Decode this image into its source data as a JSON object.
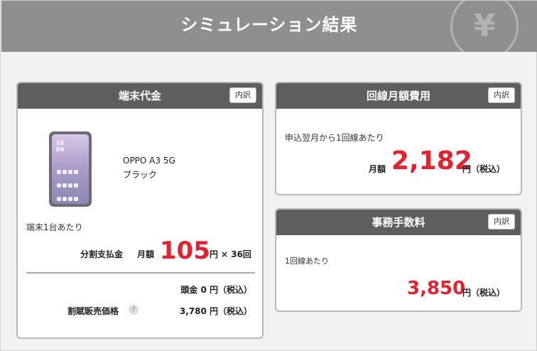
{
  "banner": {
    "title": "シミュレーション結果",
    "icon": "yen-icon",
    "icon_glyph": "¥"
  },
  "device_card": {
    "title": "端末代金",
    "detail_label": "内訳",
    "phone_clock": "10\n00",
    "product_name": "OPPO A3 5G",
    "product_color": "ブラック",
    "per_unit": "端末1台あたり",
    "payment_label": "分割支払金",
    "monthly_label": "月額",
    "monthly_amount": "105",
    "unit": "円",
    "installments": "× 36回",
    "down_payment": "頭金 0 円（税込）",
    "discount_label": "割賦販売価格",
    "discount_value": "3,780 円（税込）"
  },
  "monthly_card": {
    "title": "回線月額費用",
    "detail_label": "内訳",
    "note": "申込翌月から1回線あたり",
    "monthly_label": "月額",
    "amount": "2,182",
    "unit": "円（税込）"
  },
  "fee_card": {
    "title": "事務手数料",
    "detail_label": "内訳",
    "note": "1回線あたり",
    "amount": "3,850",
    "unit": "円（税込）"
  },
  "colors": {
    "accent": "#e8202d",
    "banner": "#8f8f8f",
    "card_header": "#5e5e5e"
  }
}
